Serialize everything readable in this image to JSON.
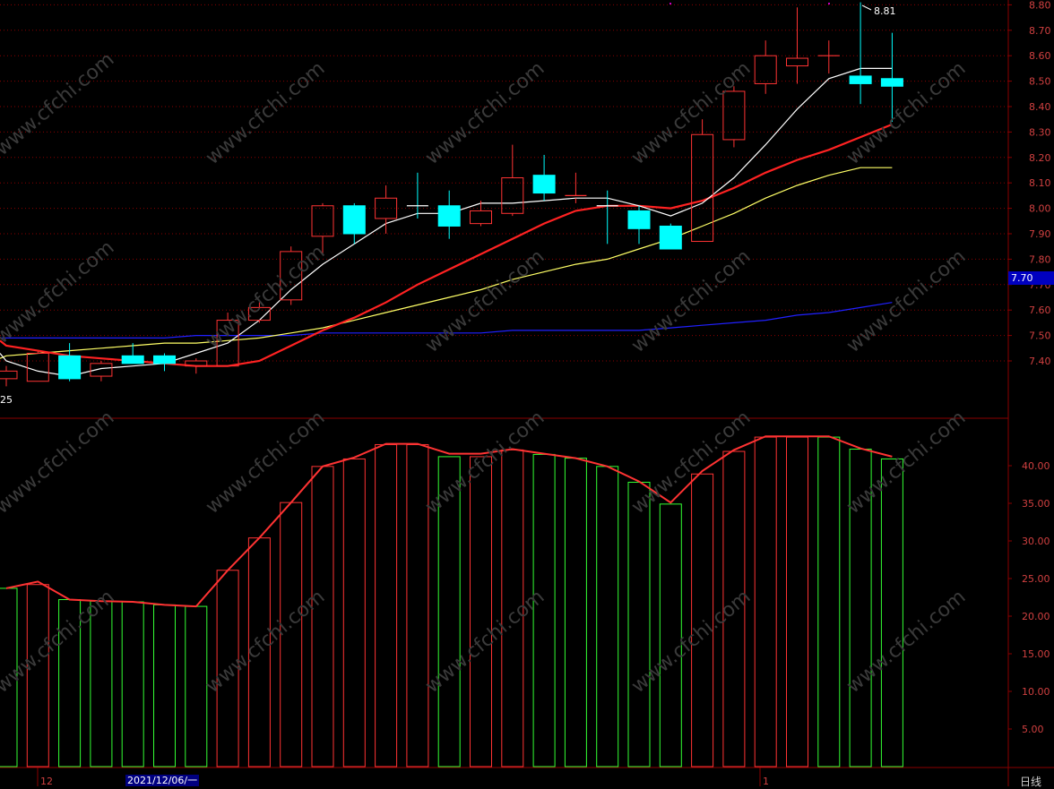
{
  "colors": {
    "background": "#000000",
    "up": "#ff3333",
    "down": "#00ffff",
    "ma5": "#ffffff",
    "ma10": "#ff2222",
    "ma20": "#ffff66",
    "ma60": "#2020ff",
    "grid": "#8b0000",
    "axis_text": "#d04040",
    "vol_down": "#33ff33",
    "watermark": "#3a3a3a"
  },
  "watermark": "www.cfchi.com",
  "price_axis": {
    "ticks": [
      "8.80",
      "8.70",
      "8.60",
      "8.50",
      "8.40",
      "8.30",
      "8.20",
      "8.10",
      "8.00",
      "7.90",
      "7.80",
      "7.70",
      "7.60",
      "7.50",
      "7.40"
    ]
  },
  "lower_axis": {
    "ticks": [
      "40.00",
      "35.00",
      "30.00",
      "25.00",
      "20.00",
      "15.00",
      "10.00",
      "5.00"
    ]
  },
  "labels": {
    "current_price": "7.70",
    "high_marker": "8.81",
    "low_marker": "25",
    "x_label_month": "12",
    "x_label_date": "2021/12/06/一",
    "x_label_next": "1",
    "period": "日线"
  },
  "chart_data": [
    {
      "type": "candlestick",
      "ylim": [
        7.2,
        8.85
      ],
      "candles": [
        {
          "o": 7.33,
          "h": 7.38,
          "l": 7.3,
          "c": 7.36,
          "up": true
        },
        {
          "o": 7.32,
          "h": 7.44,
          "l": 7.32,
          "c": 7.43,
          "up": true
        },
        {
          "o": 7.42,
          "h": 7.47,
          "l": 7.32,
          "c": 7.33,
          "up": false
        },
        {
          "o": 7.34,
          "h": 7.4,
          "l": 7.32,
          "c": 7.39,
          "up": true
        },
        {
          "o": 7.42,
          "h": 7.47,
          "l": 7.39,
          "c": 7.39,
          "up": false
        },
        {
          "o": 7.42,
          "h": 7.43,
          "l": 7.36,
          "c": 7.39,
          "up": false
        },
        {
          "o": 7.38,
          "h": 7.41,
          "l": 7.35,
          "c": 7.4,
          "up": true
        },
        {
          "o": 7.38,
          "h": 7.59,
          "l": 7.38,
          "c": 7.56,
          "up": true
        },
        {
          "o": 7.56,
          "h": 7.63,
          "l": 7.55,
          "c": 7.61,
          "up": true
        },
        {
          "o": 7.64,
          "h": 7.85,
          "l": 7.62,
          "c": 7.83,
          "up": true
        },
        {
          "o": 7.89,
          "h": 8.02,
          "l": 7.82,
          "c": 8.01,
          "up": true
        },
        {
          "o": 8.01,
          "h": 8.02,
          "l": 7.86,
          "c": 7.9,
          "up": false
        },
        {
          "o": 7.96,
          "h": 8.09,
          "l": 7.9,
          "c": 8.04,
          "up": true
        },
        {
          "o": 8.01,
          "h": 8.14,
          "l": 7.96,
          "c": 8.01,
          "up": false
        },
        {
          "o": 8.01,
          "h": 8.07,
          "l": 7.88,
          "c": 7.93,
          "up": false
        },
        {
          "o": 7.94,
          "h": 8.03,
          "l": 7.93,
          "c": 7.99,
          "up": true
        },
        {
          "o": 7.98,
          "h": 8.25,
          "l": 7.97,
          "c": 8.12,
          "up": true
        },
        {
          "o": 8.13,
          "h": 8.21,
          "l": 8.03,
          "c": 8.06,
          "up": false
        },
        {
          "o": 8.04,
          "h": 8.14,
          "l": 8.02,
          "c": 8.05,
          "up": true
        },
        {
          "o": 8.01,
          "h": 8.07,
          "l": 7.86,
          "c": 8.01,
          "up": false
        },
        {
          "o": 7.99,
          "h": 8.01,
          "l": 7.86,
          "c": 7.92,
          "up": false
        },
        {
          "o": 7.93,
          "h": 7.94,
          "l": 7.84,
          "c": 7.84,
          "up": false
        },
        {
          "o": 7.87,
          "h": 8.35,
          "l": 7.87,
          "c": 8.29,
          "up": true
        },
        {
          "o": 8.27,
          "h": 8.48,
          "l": 8.24,
          "c": 8.46,
          "up": true
        },
        {
          "o": 8.49,
          "h": 8.66,
          "l": 8.45,
          "c": 8.6,
          "up": true
        },
        {
          "o": 8.56,
          "h": 8.79,
          "l": 8.49,
          "c": 8.59,
          "up": true
        },
        {
          "o": 8.6,
          "h": 8.66,
          "l": 8.53,
          "c": 8.6,
          "up": true
        },
        {
          "o": 8.52,
          "h": 8.81,
          "l": 8.41,
          "c": 8.49,
          "up": false
        },
        {
          "o": 8.51,
          "h": 8.69,
          "l": 8.34,
          "c": 8.48,
          "up": false
        }
      ],
      "ma5": [
        7.43,
        7.4,
        7.36,
        7.34,
        7.37,
        7.38,
        7.39,
        7.43,
        7.47,
        7.56,
        7.68,
        7.78,
        7.86,
        7.94,
        7.98,
        7.98,
        8.02,
        8.02,
        8.03,
        8.04,
        8.04,
        8.01,
        7.97,
        8.02,
        8.12,
        8.25,
        8.39,
        8.51,
        8.55,
        8.55
      ],
      "ma10": [
        7.48,
        7.46,
        7.44,
        7.42,
        7.41,
        7.4,
        7.39,
        7.38,
        7.38,
        7.4,
        7.46,
        7.52,
        7.57,
        7.63,
        7.7,
        7.76,
        7.82,
        7.88,
        7.94,
        7.99,
        8.01,
        8.01,
        8.0,
        8.03,
        8.08,
        8.14,
        8.19,
        8.23,
        8.28,
        8.33
      ],
      "ma20": [
        7.41,
        7.42,
        7.43,
        7.44,
        7.45,
        7.46,
        7.47,
        7.47,
        7.48,
        7.49,
        7.51,
        7.53,
        7.56,
        7.59,
        7.62,
        7.65,
        7.68,
        7.72,
        7.75,
        7.78,
        7.8,
        7.84,
        7.88,
        7.93,
        7.98,
        8.04,
        8.09,
        8.13,
        8.16,
        8.16
      ],
      "ma60": [
        7.49,
        7.49,
        7.49,
        7.49,
        7.49,
        7.49,
        7.49,
        7.5,
        7.5,
        7.5,
        7.5,
        7.51,
        7.51,
        7.51,
        7.51,
        7.51,
        7.51,
        7.52,
        7.52,
        7.52,
        7.52,
        7.52,
        7.53,
        7.54,
        7.55,
        7.56,
        7.58,
        7.59,
        7.61,
        7.63
      ]
    },
    {
      "type": "bar",
      "ylim": [
        0,
        45
      ],
      "values": [
        23.7,
        24.2,
        22.2,
        22.0,
        21.9,
        21.5,
        21.3,
        26.1,
        30.4,
        35.1,
        39.9,
        40.9,
        42.8,
        42.8,
        41.2,
        41.2,
        42.1,
        41.5,
        41.0,
        39.9,
        37.8,
        34.9,
        38.9,
        41.9,
        43.8,
        43.8,
        43.8,
        42.2,
        40.9
      ],
      "up": [
        false,
        true,
        false,
        false,
        false,
        false,
        false,
        true,
        true,
        true,
        true,
        true,
        true,
        true,
        false,
        true,
        true,
        false,
        false,
        false,
        false,
        false,
        true,
        true,
        true,
        true,
        false,
        false,
        false
      ],
      "line": [
        23.7,
        24.6,
        22.2,
        22.0,
        21.9,
        21.5,
        21.3,
        26.1,
        30.4,
        35.1,
        39.9,
        41.1,
        42.9,
        42.9,
        41.6,
        41.6,
        42.2,
        41.6,
        41.0,
        39.9,
        37.9,
        35.1,
        39.3,
        42.1,
        43.9,
        43.9,
        43.9,
        42.3,
        41.2
      ]
    }
  ]
}
